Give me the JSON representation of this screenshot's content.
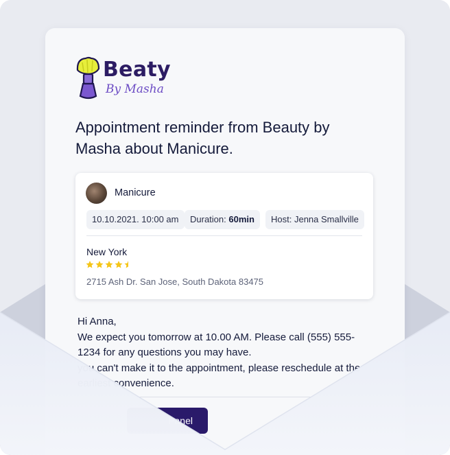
{
  "brand": {
    "name": "Beaty",
    "tagline": "By Masha",
    "colors": {
      "primary": "#2c1c63",
      "accent": "#6c4cc4",
      "brush_head": "#e6ec3a",
      "star": "#f5c518"
    }
  },
  "email": {
    "headline": "Appointment reminder from Beauty by Masha about Manicure.",
    "appointment": {
      "service": "Manicure",
      "datetime": "10.10.2021. 10:00 am",
      "duration_label": "Duration:",
      "duration_value": "60min",
      "host_label": "Host:",
      "host_value": "Jenna Smallville",
      "location_city": "New York",
      "rating": 4.5,
      "rating_max": 5,
      "address": "2715 Ash Dr. San Jose, South Dakota 83475"
    },
    "body": {
      "greeting": "Hi Anna,",
      "line1": "We expect you tomorrow at 10.00 AM. Please call (555) 555-1234 for any questions you may have.",
      "line2": "you can't make it to the appointment, please reschedule at the earliest convenience."
    },
    "cta_label": "Panel"
  },
  "icons": {
    "logo": "makeup-brush-icon",
    "avatar": "service-avatar",
    "star": "star-icon"
  }
}
